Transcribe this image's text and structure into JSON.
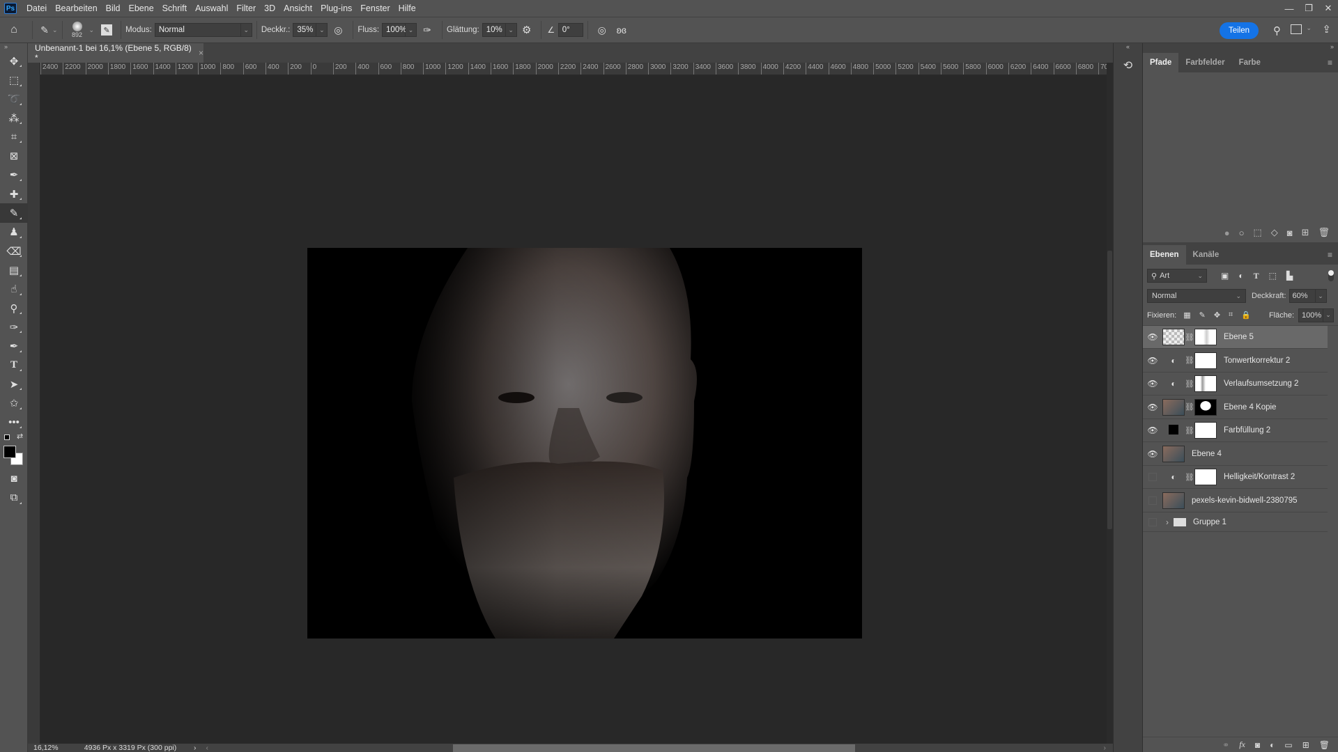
{
  "app": {
    "logo": "Ps"
  },
  "menu": [
    "Datei",
    "Bearbeiten",
    "Bild",
    "Ebene",
    "Schrift",
    "Auswahl",
    "Filter",
    "3D",
    "Ansicht",
    "Plug-ins",
    "Fenster",
    "Hilfe"
  ],
  "window_controls": {
    "minimize": "—",
    "restore": "❐",
    "close": "✕"
  },
  "options": {
    "brush_size": "892",
    "modus_label": "Modus:",
    "modus_value": "Normal",
    "deckkr_label": "Deckkr.:",
    "deckkr_value": "35%",
    "fluss_label": "Fluss:",
    "fluss_value": "100%",
    "glaettung_label": "Glättung:",
    "glaettung_value": "10%",
    "angle_value": "0°",
    "share_label": "Teilen"
  },
  "document": {
    "tab_title": "Unbenannt-1 bei 16,1% (Ebene 5, RGB/8) *",
    "close": "×",
    "zoom": "16,12%",
    "dimensions": "4936 Px x 3319 Px (300 ppi)"
  },
  "ruler_ticks": [
    "2400",
    "2200",
    "2000",
    "1800",
    "1600",
    "1400",
    "1200",
    "1000",
    "800",
    "600",
    "400",
    "200",
    "0",
    "200",
    "400",
    "600",
    "800",
    "1000",
    "1200",
    "1400",
    "1600",
    "1800",
    "2000",
    "2200",
    "2400",
    "2600",
    "2800",
    "3000",
    "3200",
    "3400",
    "3600",
    "3800",
    "4000",
    "4200",
    "4400",
    "4600",
    "4800",
    "5000",
    "5200",
    "5400",
    "5600",
    "5800",
    "6000",
    "6200",
    "6400",
    "6600",
    "6800",
    "70"
  ],
  "top_panel": {
    "tabs": [
      "Pfade",
      "Farbfelder",
      "Farbe"
    ],
    "active_tab": "Pfade"
  },
  "layers_panel": {
    "tabs": [
      "Ebenen",
      "Kanäle"
    ],
    "filter_value": "Art",
    "blend_mode": "Normal",
    "opacity_label": "Deckkraft:",
    "opacity_value": "60%",
    "lock_label": "Fixieren:",
    "fill_label": "Fläche:",
    "fill_value": "100%",
    "layers": [
      {
        "name": "Ebene 5",
        "visible": true,
        "selected": true,
        "type": "pixel-with-mask"
      },
      {
        "name": "Tonwertkorrektur 2",
        "visible": true,
        "selected": false,
        "type": "adjustment"
      },
      {
        "name": "Verlaufsumsetzung 2",
        "visible": true,
        "selected": false,
        "type": "adjustment"
      },
      {
        "name": "Ebene 4 Kopie",
        "visible": true,
        "selected": false,
        "type": "pixel-with-mask"
      },
      {
        "name": "Farbfüllung 2",
        "visible": true,
        "selected": false,
        "type": "fill"
      },
      {
        "name": "Ebene 4",
        "visible": true,
        "selected": false,
        "type": "pixel"
      },
      {
        "name": "Helligkeit/Kontrast 2",
        "visible": false,
        "selected": false,
        "type": "adjustment"
      },
      {
        "name": "pexels-kevin-bidwell-2380795",
        "visible": false,
        "selected": false,
        "type": "smart-object"
      },
      {
        "name": "Gruppe 1",
        "visible": false,
        "selected": false,
        "type": "group"
      }
    ]
  },
  "colors": {
    "accent": "#1473e6",
    "panel": "#535353",
    "canvas_bg": "#282828"
  }
}
